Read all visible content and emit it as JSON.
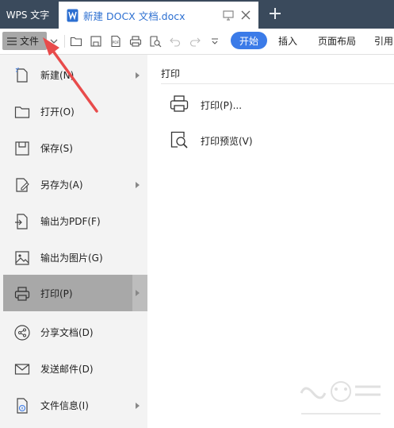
{
  "tabbar": {
    "app_name": "WPS 文字",
    "doc_title": "新建 DOCX 文档.docx"
  },
  "toolbar": {
    "file_label": "文件",
    "ribbon_tabs": [
      "开始",
      "插入",
      "页面布局",
      "引用"
    ],
    "active_tab": "开始"
  },
  "menu": {
    "items": [
      {
        "label": "新建(N)",
        "icon": "new-doc-icon",
        "has_submenu": true
      },
      {
        "label": "打开(O)",
        "icon": "folder-open-icon",
        "has_submenu": false
      },
      {
        "label": "保存(S)",
        "icon": "save-icon",
        "has_submenu": false
      },
      {
        "label": "另存为(A)",
        "icon": "save-as-icon",
        "has_submenu": true
      },
      {
        "label": "输出为PDF(F)",
        "icon": "export-pdf-icon",
        "has_submenu": false
      },
      {
        "label": "输出为图片(G)",
        "icon": "export-image-icon",
        "has_submenu": false
      },
      {
        "label": "打印(P)",
        "icon": "printer-icon",
        "has_submenu": true,
        "selected": true
      },
      {
        "label": "分享文档(D)",
        "icon": "share-icon",
        "has_submenu": false
      },
      {
        "label": "发送邮件(D)",
        "icon": "mail-icon",
        "has_submenu": false
      },
      {
        "label": "文件信息(I)",
        "icon": "file-info-icon",
        "has_submenu": true
      }
    ]
  },
  "panel": {
    "title": "打印",
    "items": [
      {
        "label": "打印(P)...",
        "icon": "printer-icon"
      },
      {
        "label": "打印预览(V)",
        "icon": "print-preview-icon"
      }
    ]
  },
  "colors": {
    "tabbar_bg": "#3a4a5c",
    "accent": "#3b7be8",
    "selected_bg": "#a8a8a8",
    "annotation_arrow": "#e84b4b"
  }
}
